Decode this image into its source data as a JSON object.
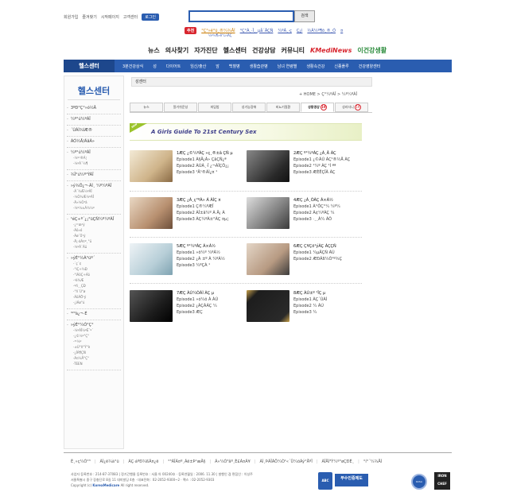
{
  "header": {
    "top_links": [
      "회원가입",
      "즐겨찾기",
      "시작페이지",
      "고객센터"
    ],
    "login_label": "로그인",
    "search_placeholder": "",
    "search_button": "검색",
    "recommend_tag": "추천",
    "recommend_items": [
      "°Ç°­»ê°ü¸®¼¾ÅÍ",
      "°Ç°­À¸·Î¸¸µå´ÂÇÑ",
      "¼ºÀ¸·ç",
      "Ç¿ì",
      "½Ã¼º¶õ¸®¸Ó",
      "¤"
    ],
    "recommend_sub": "¼º¼¶»ê°ú·ïÀÇ"
  },
  "gnb": {
    "items": [
      "뉴스",
      "의사찾기",
      "자가진단",
      "헬스센터",
      "건강상담",
      "커뮤니티"
    ],
    "logo1": "KMediNews",
    "logo2": "이건강생활"
  },
  "subnav": {
    "title": "헬스센터",
    "items": [
      "3분건강상식",
      "성",
      "다이어트",
      "임신/출산",
      "암",
      "백혈병",
      "생활습관병",
      "남녀 연령별",
      "생활속건강",
      "신종플루",
      "건강영양센터"
    ]
  },
  "sidebar": {
    "title": "헬스센터",
    "groups": [
      {
        "label": "3ºÐ°Ç°­»ó½Ä",
        "subs": []
      },
      {
        "label": "¼º°ú¼ºÀÎ",
        "subs": []
      },
      {
        "label": "´ÙÀÌ¾îÆ®",
        "subs": []
      },
      {
        "label": "ÀÓ½Å/ÃâÃ»",
        "subs": []
      },
      {
        "label": "¼º°ú¼ºÀÎ",
        "subs": [
          "-¼º¹®Á¦",
          "-¼ºÀ¯¼¶"
        ]
      },
      {
        "label": "¾Ï°ú¼º¹ÝÀÎ",
        "subs": []
      },
      {
        "label": "»ý¾Ö¿¬·ÀÌ¸ ¼º¼ºÀÎ",
        "subs": [
          "-À¯¾Æ¼ºÀÎ",
          "-¼Ò¾Æ¼ºÀÎ",
          "-Ã»¼Ò³â",
          "-¼º¼±Á¾¼º"
        ]
      },
      {
        "label": "¹éÇ÷º´¿¡°üÇÑ¼º¼ºÀÎ",
        "subs": [
          "-¿¹¹æ¹ý",
          "-Áõ»ó",
          "-Áø´Ü¹ý",
          "-Ä¡·áÁ¤º¸°ü",
          "-¼ºÀ¯Àü"
        ]
      },
      {
        "label": "»ýÈ°½À°üº´",
        "subs": [
          "-´ç´¢",
          "-°íÇ÷¾Ð",
          "-°íÁöÇ÷Áõ",
          "-¹è¾Æ",
          "-ºñ¸¸ÇÐ",
          "-°ñ´Ù°ø",
          "-ÁöÁÖ¹ý",
          "-¿ìÁø°ú"
        ]
      },
      {
        "label": "³²³à¿¬·É",
        "subs": []
      },
      {
        "label": "»ýÈ°¼Ó°Ç°­",
        "subs": [
          "-¼ºÀÎ¼ºÈ¯º´",
          "-¿©¼º°Ç°­",
          "-³²¼º",
          "-±Ù°ñ°Ý°è",
          "-¿ÍÁ¶ÇÑ",
          "-Á¤½Å°Ç°­",
          "-TEEN"
        ]
      }
    ]
  },
  "content": {
    "location_title": "성센터",
    "breadcrumb": "+ HOME > Ç°¼ºÀÎ > ¼º¼ºÀÎ",
    "tabs": [
      {
        "label": "뉴스",
        "active": false
      },
      {
        "label": "알기쉬운성",
        "active": false
      },
      {
        "label": "피임법",
        "active": false
      },
      {
        "label": "성기능장애",
        "active": false
      },
      {
        "label": "비뇨기질환",
        "active": false
      },
      {
        "label": "성동영상",
        "active": true,
        "badge": "19"
      },
      {
        "label": "성리더니",
        "active": false,
        "badge": "19"
      }
    ],
    "banner_new": "NEW",
    "banner_title": "A Girls Guide To 21st Century Sex",
    "items": [
      {
        "title": "1ÆÇ ¿©¼ºÀÇ »ç¸®±â ÇÑ µ",
        "eps": [
          "Episode1  À§Ä¡Á» ÇâÇÑ¿ª",
          "Episode2  ÀÚÀ¸·Î ¿¬ÀÎÇÔ¿¡",
          "Episode3  ¹Ä¹®ÀÌ¿¤ ¹"
        ]
      },
      {
        "title": "2ÆÇ º¹¼ºÀÇ ¿À¸Â ÀÇ",
        "eps": [
          "Episode1  ¿©ÀÚ ÀÇ¹®½Å ÀÇ",
          "Episode2  ¹¼º ÀÇ ¹Ì ªª",
          "Episode3  ÆÈÊÇÎÃ ÀÇ"
        ]
      },
      {
        "title": "3ÆÇ ¿À¸ç°ºÀ» Á ÀÌÇ ¤",
        "eps": [
          "Episode1  Ç®¼ºÆÎ",
          "Episode2  ÀÎ±â¼º À Ä¡ À",
          "Episode3  ÀÇ¼ºÀ±°ÀÇ ¤µ¦"
        ]
      },
      {
        "title": "4ÆÇ ¿À¸ÓÀÇ Á×À½",
        "eps": [
          "Episode1  À°ÔÇ°¼ ¼º¼",
          "Episode2  Ã¢¼ºÀÇ ¼",
          "Episode3  ·¸¸À¼ ÀÔ"
        ]
      },
      {
        "title": "5ÆÇ º¹¼ºÀÇ Á×À½",
        "eps": [
          "Episode1  »ö¼º ¼ºÀ½",
          "Episode2  ¿À ±º À ¼ºÀ½",
          "Episode3  ¼ºÇÀ ¹"
        ]
      },
      {
        "title": "6ÆÇ Ç¥Çö¹ýÀÇ ÀÇÇÑ",
        "eps": [
          "Episode1  ¼µÂÇÑ ÀÚ",
          "Episode2  ÆÐÃß¼Ò¹º¾Ç"
        ]
      },
      {
        "title": "7ÆÇ ÀÚ¼ÒÀÌ ÀÇ µ",
        "eps": [
          "Episode1  »ó¼ô À ÀÚ",
          "Episode2  ¿ÀÇÁÀÇ ¼",
          "Episode3  ÆÇ"
        ]
      },
      {
        "title": "8ÆÇ ÀÚ±º ¹ÎÇ µ",
        "eps": [
          "Episode1  ÀÇ´ÙÀÌ",
          "Episode2  ¼ ÀÚ",
          "Episode3  ¼"
        ]
      }
    ]
  },
  "footer": {
    "links": [
      "È¸»ç¼Ò°³",
      "ÀÌ¿ë¾à°ü",
      "ÀÇ·áºÐ¾ßÃ¤¿ë",
      "°³ÀÎÁ¤º¸Ãë±Þ¹æÄ§",
      "Ã»¼Ò³âº¸È£Á¤Ã¥",
      "ÀÌ¸ÞÀÏÁÖ¼Ò¹«´Ü¼öÁý°ÅºÎ",
      "ÀÎÅÍ³Ý¼º°øÇÐÈ¸",
      "°í°´¼¾ÅÍ"
    ],
    "line1": "사업자 등록번호 : 214-87-37083 | 정기간행물 등록번호 : 서울 아 00240호 · 등록연월일 : 2006. 11.30 | 발행인 겸 편집인 : 이성주",
    "line2": "서울특별시 중구 장충단로 8길 11 대미빌딩 4층 · 대표전화 : 02-2052-9300~2 · 팩스 : 02-2052-9303",
    "copyright_prefix": "Copyright (c)",
    "copyright_brand": "KoreaMedicare",
    "copyright_suffix": "All right reserved.",
    "badges": [
      "ABC",
      "부수인증제도",
      "KCSA",
      "IRON CHEF"
    ]
  }
}
